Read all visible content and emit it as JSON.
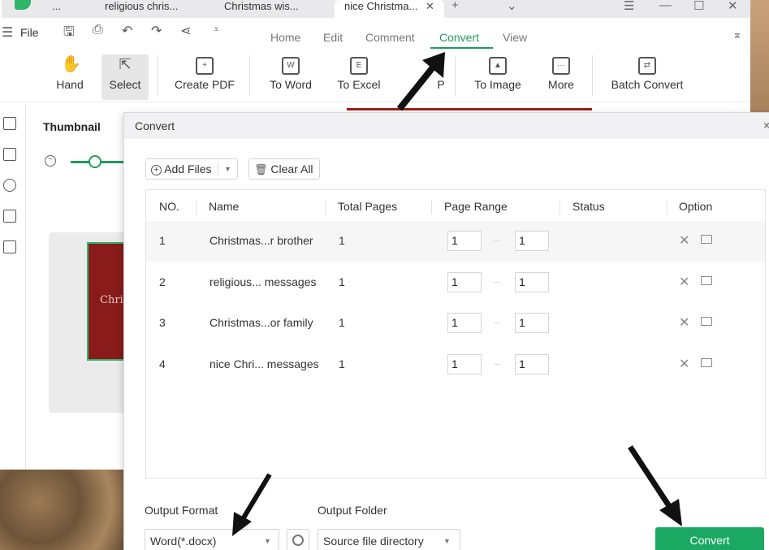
{
  "tabs": [
    {
      "label": "..."
    },
    {
      "label": "religious chris..."
    },
    {
      "label": "Christmas wis..."
    },
    {
      "label": "nice Christma...",
      "active": true
    }
  ],
  "window_controls": {
    "new_tab": "+",
    "dropdown": "⌄",
    "menu": "☰",
    "minimize": "—",
    "maximize": "☐",
    "close": "✕"
  },
  "menu": {
    "file_label": "File"
  },
  "nav": {
    "items": [
      "Home",
      "Edit",
      "Comment",
      "Convert",
      "View"
    ],
    "active": "Convert"
  },
  "toolbar": {
    "hand": "Hand",
    "select": "Select",
    "create_pdf": "Create PDF",
    "to_word": "To Word",
    "to_excel": "To Excel",
    "to_ppt": "P",
    "to_image": "To Image",
    "more": "More",
    "batch_convert": "Batch Convert"
  },
  "thumbnail_panel": {
    "title": "Thumbnail",
    "zoom_out": "−",
    "page_text": "Chri"
  },
  "dialog": {
    "title": "Convert",
    "close": "×",
    "add_files": "Add Files",
    "clear_all": "Clear All",
    "columns": [
      "NO.",
      "Name",
      "Total Pages",
      "Page Range",
      "Status",
      "Option"
    ],
    "rows": [
      {
        "no": "1",
        "name": "Christmas...r brother",
        "total": "1",
        "from": "1",
        "to": "1"
      },
      {
        "no": "2",
        "name": "religious... messages",
        "total": "1",
        "from": "1",
        "to": "1"
      },
      {
        "no": "3",
        "name": "Christmas...or family",
        "total": "1",
        "from": "1",
        "to": "1"
      },
      {
        "no": "4",
        "name": "nice Chri... messages",
        "total": "1",
        "from": "1",
        "to": "1"
      }
    ],
    "output_format_label": "Output Format",
    "output_format_value": "Word(*.docx)",
    "output_folder_label": "Output Folder",
    "output_folder_value": "Source file directory",
    "convert_button": "Convert"
  },
  "colors": {
    "accent": "#1f9a5c",
    "convert_button": "#1aa863"
  }
}
